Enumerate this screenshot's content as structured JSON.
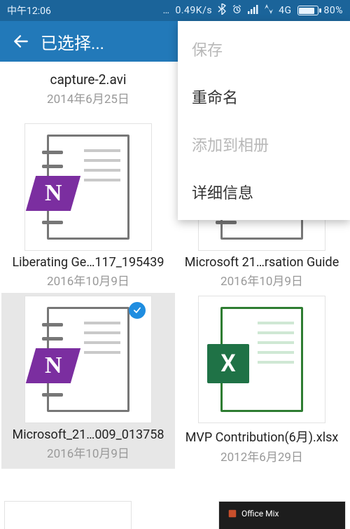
{
  "statusbar": {
    "time": "中午12:06",
    "net_speed": "0.49K/s",
    "network_label": "4G",
    "battery_pct": "80%"
  },
  "actionbar": {
    "title": "已选择..."
  },
  "context_menu": {
    "items": [
      {
        "label": "保存",
        "disabled": true
      },
      {
        "label": "重命名",
        "disabled": false
      },
      {
        "label": "添加到相册",
        "disabled": true
      },
      {
        "label": "详细信息",
        "disabled": false
      }
    ]
  },
  "files": [
    {
      "name": "capture-2.avi",
      "date": "2014年6月25日",
      "type": "video",
      "selected": false
    },
    {
      "name": "Liberating Ge…117_195439",
      "date": "2016年10月9日",
      "type": "onenote",
      "selected": false
    },
    {
      "name": "Microsoft 21…rsation Guide",
      "date": "2016年10月9日",
      "type": "onenote",
      "selected": false
    },
    {
      "name": "Microsoft_21…009_013758",
      "date": "2016年10月9日",
      "type": "onenote",
      "selected": true
    },
    {
      "name": "MVP Contribution(6月).xlsx",
      "date": "2012年6月29日",
      "type": "excel",
      "selected": false
    }
  ],
  "peek": {
    "officemix": "Office Mix"
  },
  "colors": {
    "primary": "#2279b9",
    "primary_dark": "#1b649a",
    "accent_purple": "#7b2ea0",
    "accent_green": "#1f7246",
    "check": "#1f8de0"
  }
}
